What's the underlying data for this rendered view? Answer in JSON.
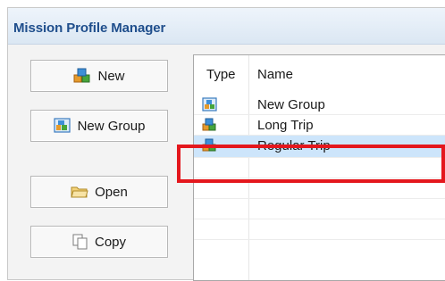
{
  "window": {
    "title": "Mission Profile Manager"
  },
  "buttons": {
    "new": "New",
    "new_group": "New Group",
    "open": "Open",
    "copy": "Copy"
  },
  "table": {
    "headers": {
      "type": "Type",
      "name": "Name"
    },
    "rows": [
      {
        "name": "New Group",
        "icon": "group-icon"
      },
      {
        "name": "Long Trip",
        "icon": "mission-icon"
      },
      {
        "name": "Regular Trip",
        "icon": "mission-icon",
        "selected": true
      },
      {
        "name": ""
      },
      {
        "name": ""
      },
      {
        "name": ""
      },
      {
        "name": ""
      }
    ]
  },
  "colors": {
    "title_text": "#1f4e8c",
    "selection": "#cde5fb",
    "highlight_border": "#e4171d"
  }
}
